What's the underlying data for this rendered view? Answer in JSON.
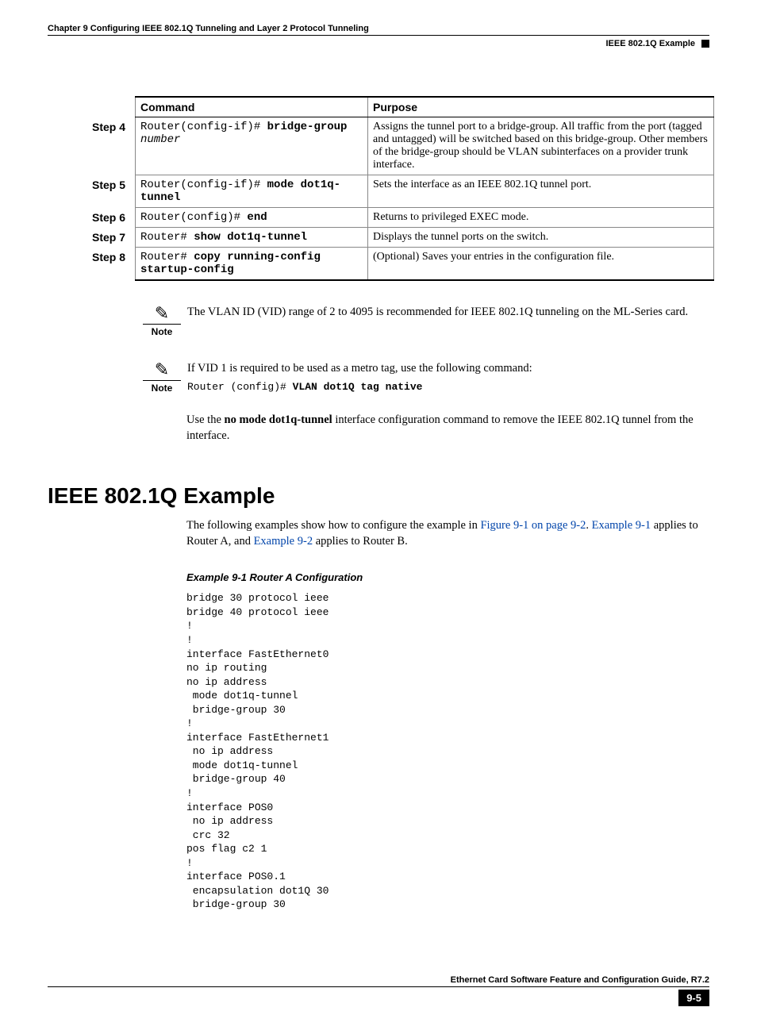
{
  "header": {
    "chapter": "Chapter 9    Configuring IEEE 802.1Q Tunneling and Layer 2 Protocol Tunneling",
    "section": "IEEE 802.1Q Example"
  },
  "table": {
    "headers": {
      "command": "Command",
      "purpose": "Purpose"
    },
    "rows": [
      {
        "step": "Step 4",
        "cmd_prefix": "Router(config-if)# ",
        "cmd_bold": "bridge-group",
        "cmd_italic": " number",
        "purpose": "Assigns the tunnel port to a bridge-group. All traffic from the port (tagged and untagged) will be switched based on this bridge-group. Other members of the bridge-group should be VLAN subinterfaces on a provider trunk interface."
      },
      {
        "step": "Step 5",
        "cmd_prefix": "Router(config-if)# ",
        "cmd_bold": "mode dot1q-tunnel",
        "cmd_italic": "",
        "purpose": "Sets the interface as an IEEE 802.1Q tunnel port."
      },
      {
        "step": "Step 6",
        "cmd_prefix": "Router(config)# ",
        "cmd_bold": "end",
        "cmd_italic": "",
        "purpose": "Returns to privileged EXEC mode."
      },
      {
        "step": "Step 7",
        "cmd_prefix": "Router# ",
        "cmd_bold": "show dot1q-tunnel",
        "cmd_italic": "",
        "purpose": "Displays the tunnel ports on the switch."
      },
      {
        "step": "Step 8",
        "cmd_prefix": "Router# ",
        "cmd_bold": "copy running-config startup-config",
        "cmd_italic": "",
        "purpose": "(Optional) Saves your entries in the configuration file."
      }
    ]
  },
  "notes": {
    "label": "Note",
    "n1": "The VLAN ID (VID) range of 2 to 4095 is recommended for IEEE 802.1Q tunneling on the ML-Series card.",
    "n2_text": "If VID 1 is required to be used as a metro tag, use the following command:",
    "n2_cmd_prefix": "Router (config)# ",
    "n2_cmd_bold": "VLAN dot1Q tag native"
  },
  "para": {
    "p1_a": "Use the ",
    "p1_bold": "no mode dot1q-tunnel",
    "p1_b": " interface configuration command to remove the IEEE 802.1Q tunnel from the interface.",
    "p2_a": "The following examples show how to configure the example in ",
    "p2_link1": "Figure 9-1 on page 9-2",
    "p2_b": ". ",
    "p2_link2": "Example 9-1",
    "p2_c": " applies to Router A, and ",
    "p2_link3": "Example 9-2",
    "p2_d": " applies to Router B."
  },
  "section_title": "IEEE 802.1Q Example",
  "example": {
    "title": "Example 9-1     Router A Configuration",
    "code": "bridge 30 protocol ieee\nbridge 40 protocol ieee\n!\n!\ninterface FastEthernet0\nno ip routing\nno ip address\n mode dot1q-tunnel\n bridge-group 30\n!\ninterface FastEthernet1\n no ip address\n mode dot1q-tunnel\n bridge-group 40\n!\ninterface POS0\n no ip address\n crc 32\npos flag c2 1\n!\ninterface POS0.1\n encapsulation dot1Q 30\n bridge-group 30"
  },
  "footer": {
    "title": "Ethernet Card Software Feature and Configuration Guide, R7.2",
    "page": "9-5"
  }
}
